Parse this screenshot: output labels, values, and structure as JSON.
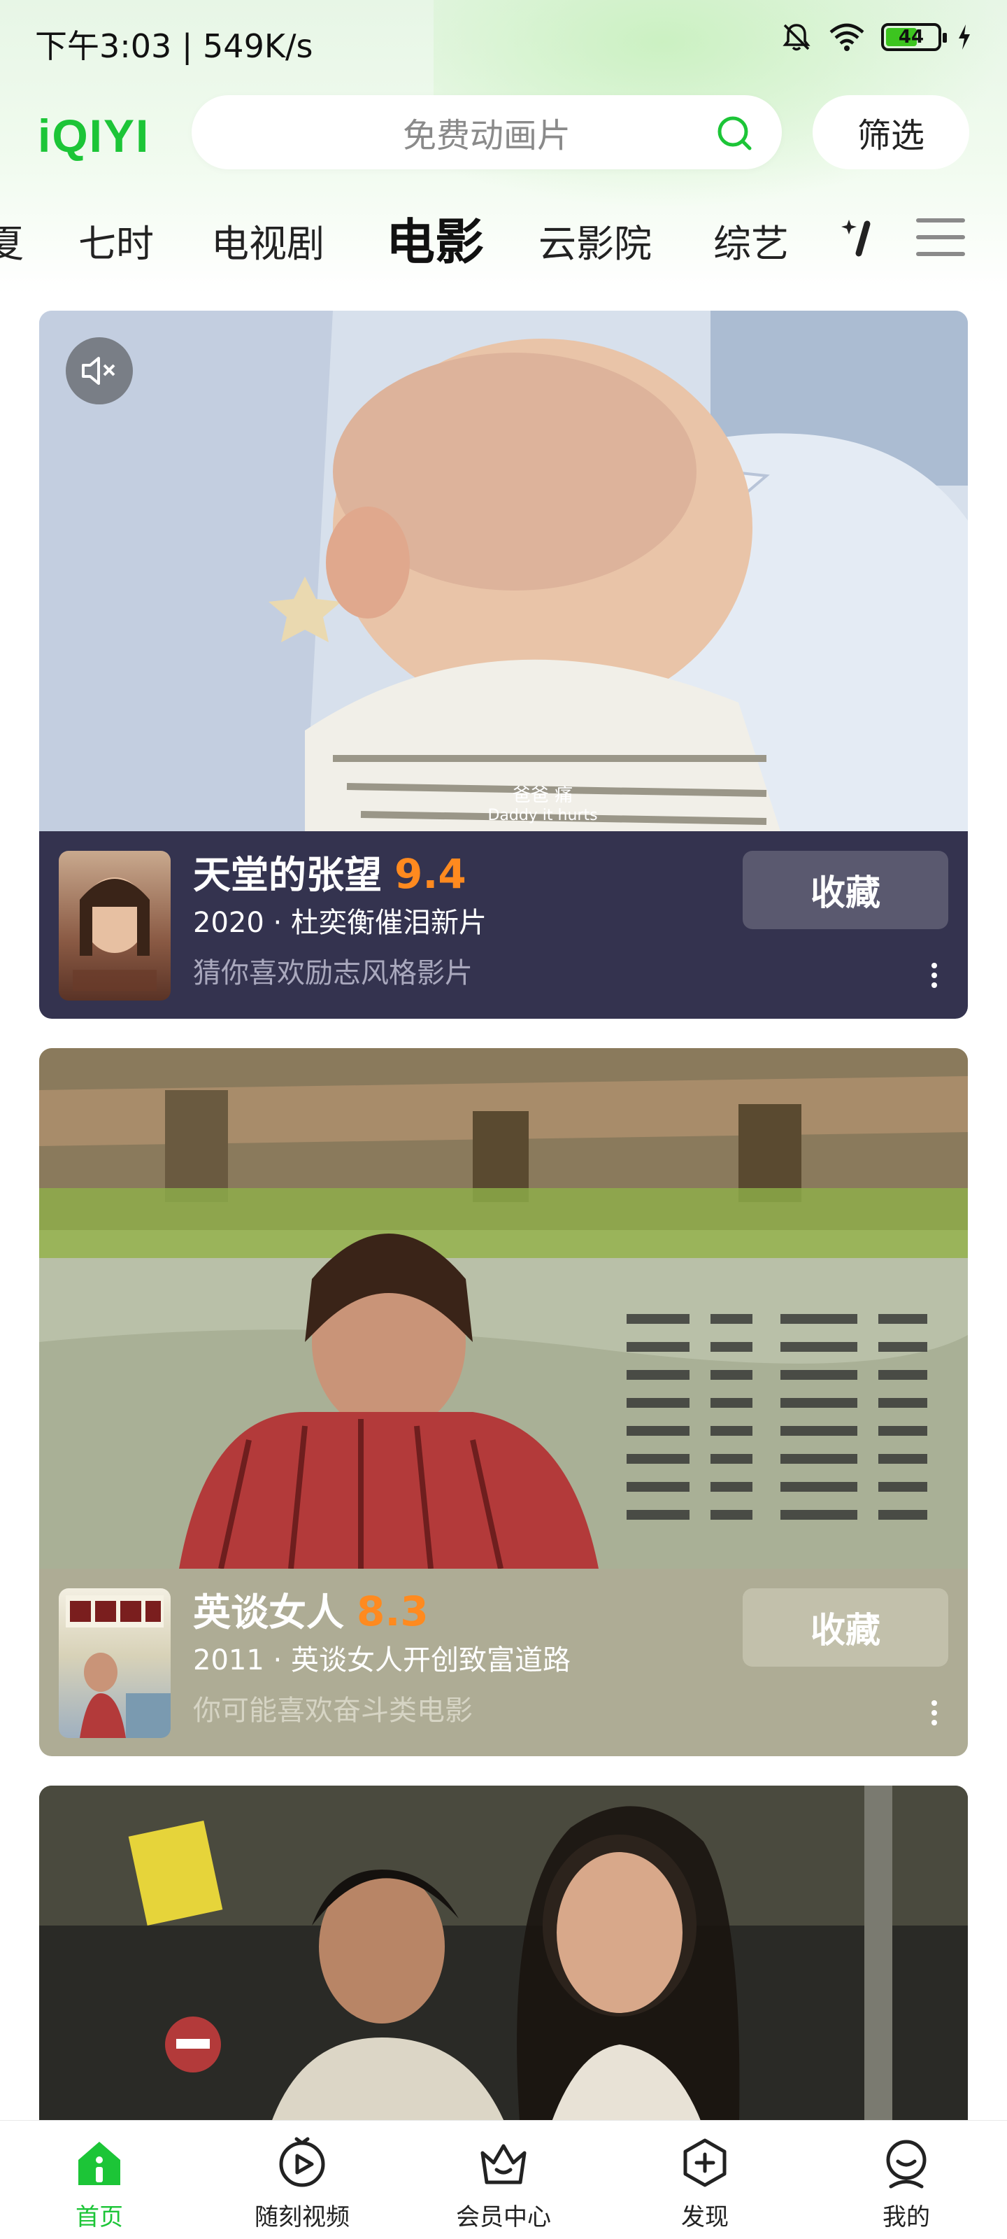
{
  "status_bar": {
    "time": "下午3:03 | 549K/s",
    "battery": "44"
  },
  "header": {
    "logo": "iQIYI",
    "search_placeholder": "免费动画片",
    "filter_label": "筛选"
  },
  "tabs": [
    {
      "label": "夏"
    },
    {
      "label": "七时"
    },
    {
      "label": "电视剧"
    },
    {
      "label": "电影",
      "active": true
    },
    {
      "label": "云影院"
    },
    {
      "label": "综艺"
    }
  ],
  "cards": [
    {
      "caption_cn": "爸爸 痛",
      "caption_en": "Daddy it hurts",
      "title": "天堂的张望",
      "score": "9.4",
      "subtitle": "2020 · 杜奕衡催泪新片",
      "reason": "猜你喜欢励志风格影片",
      "favorite_label": "收藏",
      "accent_bg": "#34334f",
      "button_bg": "#5a596f",
      "reason_color": "#a9a8bd"
    },
    {
      "title": "英谈女人",
      "score": "8.3",
      "subtitle": "2011 · 英谈女人开创致富道路",
      "reason": "你可能喜欢奋斗类电影",
      "favorite_label": "收藏",
      "accent_bg": "#aeac95",
      "button_bg": "#c2c0ab",
      "reason_color": "#d6d4c4"
    },
    {
      "title": ""
    }
  ],
  "bottom_nav": [
    {
      "label": "首页",
      "icon": "home-icon",
      "active": true
    },
    {
      "label": "随刻视频",
      "icon": "play-circle-icon"
    },
    {
      "label": "会员中心",
      "icon": "crown-icon"
    },
    {
      "label": "发现",
      "icon": "plus-circle-icon"
    },
    {
      "label": "我的",
      "icon": "profile-icon"
    }
  ],
  "colors": {
    "brand_green": "#1cc537",
    "score_orange": "#ff8a1f"
  }
}
